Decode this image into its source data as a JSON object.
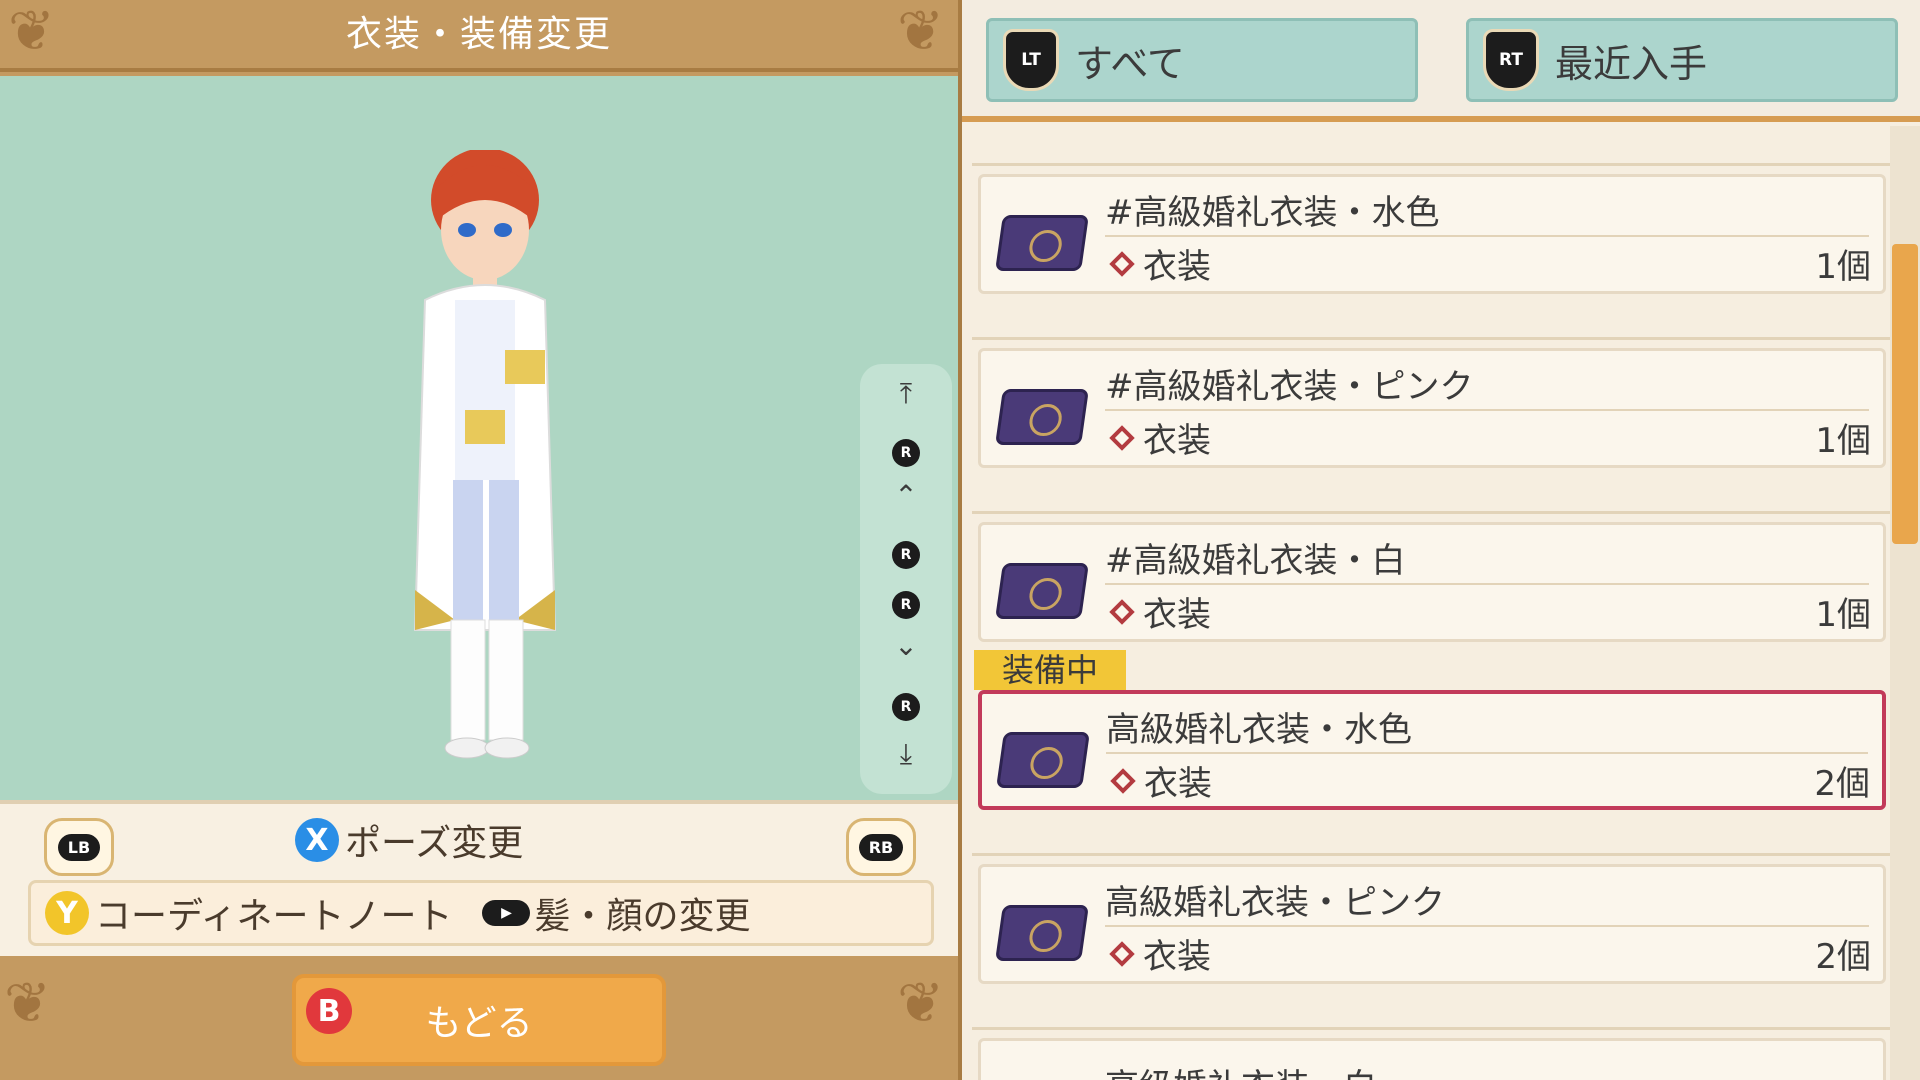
{
  "header": {
    "title": "衣装・装備変更"
  },
  "left_panel": {
    "shoulder_left": "LB",
    "shoulder_right": "RB",
    "pose": {
      "button": "X",
      "label": "ポーズ変更"
    },
    "coordinate": {
      "button": "Y",
      "label": "コーディネートノート",
      "toggle_label": "髪・顔の変更"
    },
    "back": {
      "button": "B",
      "label": "もどる"
    },
    "camera_controls": {
      "r_label": "R"
    }
  },
  "tabs": [
    {
      "button": "LT",
      "label": "すべて"
    },
    {
      "button": "RT",
      "label": "最近入手"
    }
  ],
  "equipped_tag": "装備中",
  "items": [
    {
      "name": "#高級婚礼衣装・水色",
      "category": "衣装",
      "qty": "1個"
    },
    {
      "name": "#高級婚礼衣装・ピンク",
      "category": "衣装",
      "qty": "1個"
    },
    {
      "name": "#高級婚礼衣装・白",
      "category": "衣装",
      "qty": "1個"
    },
    {
      "name": "高級婚礼衣装・水色",
      "category": "衣装",
      "qty": "2個"
    },
    {
      "name": "高級婚礼衣装・ピンク",
      "category": "衣装",
      "qty": "2個"
    },
    {
      "name": "高級婚礼衣装・白"
    }
  ],
  "colors": {
    "accent": "#e9a64c",
    "equipped_border": "#c23a5a",
    "tab_bg": "#acd5cd",
    "viewport": "#aed6c3"
  }
}
